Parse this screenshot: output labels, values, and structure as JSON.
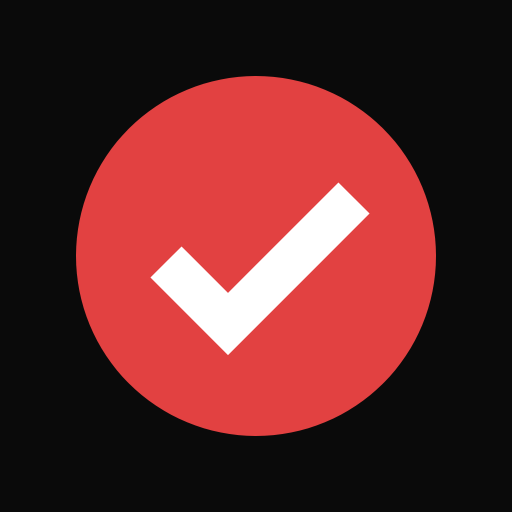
{
  "icon": {
    "name": "checkmark-icon",
    "shape": "circle-badge"
  },
  "colors": {
    "background": "#0a0a0a",
    "circle": "#e24141",
    "checkmark": "#ffffff"
  }
}
